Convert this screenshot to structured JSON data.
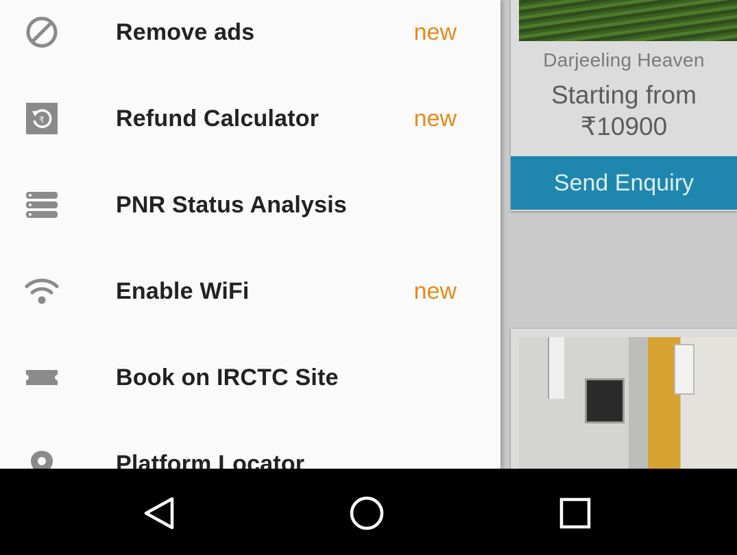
{
  "drawer": {
    "items": [
      {
        "label": "Remove ads",
        "badge": "new",
        "icon": "block-icon"
      },
      {
        "label": "Refund Calculator",
        "badge": "new",
        "icon": "refund-clock-icon"
      },
      {
        "label": "PNR Status Analysis",
        "badge": "",
        "icon": "stack-list-icon"
      },
      {
        "label": "Enable WiFi",
        "badge": "new",
        "icon": "wifi-icon"
      },
      {
        "label": "Book on IRCTC Site",
        "badge": "",
        "icon": "ticket-icon"
      },
      {
        "label": "Platform Locator",
        "badge": "",
        "icon": "location-pin-icon"
      }
    ]
  },
  "background": {
    "card1": {
      "place": "Darjeeling Heaven",
      "price_line1": "Starting from",
      "price_line2": "₹10900",
      "button": "Send Enquiry"
    }
  },
  "colors": {
    "accent_badge": "#e8891a",
    "button_blue": "#1f87ad",
    "icon_gray": "#8a8a8a"
  },
  "system_nav": {
    "buttons": [
      "back-icon",
      "home-icon",
      "recents-icon"
    ]
  }
}
